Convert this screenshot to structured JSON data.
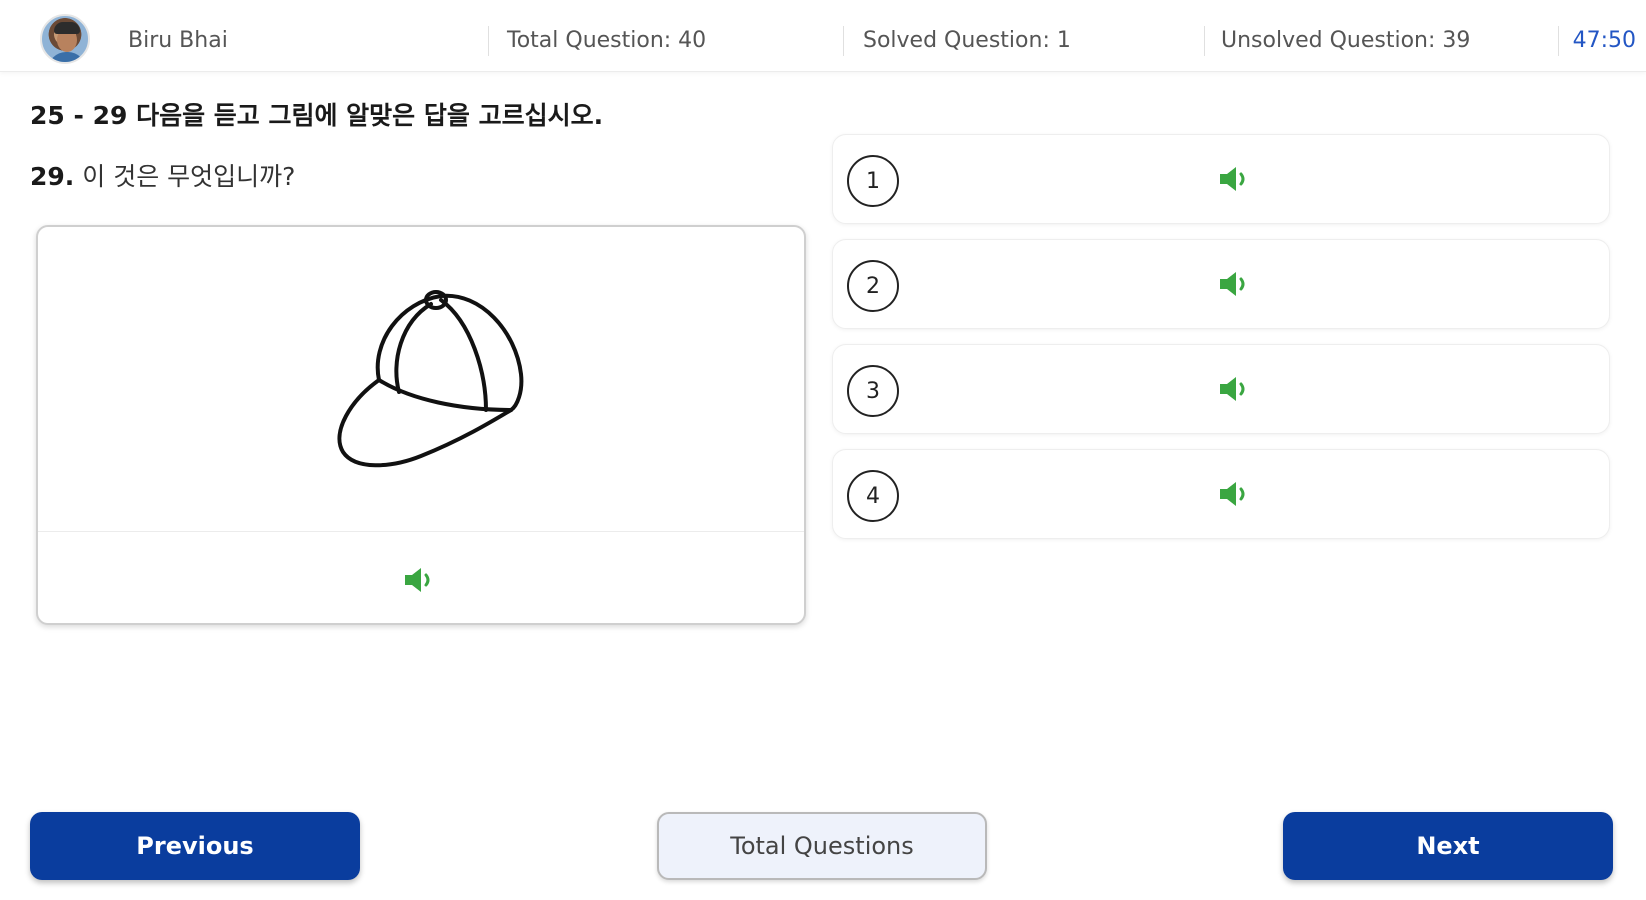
{
  "header": {
    "user_name": "Biru Bhai",
    "total_question": "Total Question: 40",
    "solved_question": "Solved Question: 1",
    "unsolved_question": "Unsolved Question: 39",
    "timer": "47:50"
  },
  "question": {
    "instruction": "25 - 29 다음을 듣고 그림에 알맞은 답을 고르십시오.",
    "number": "29.",
    "text": "이 것은 무엇입니까?"
  },
  "image_card": {
    "image_icon": "baseball-cap-drawing",
    "audio_icon": "speaker-icon"
  },
  "options": [
    {
      "label": "1"
    },
    {
      "label": "2"
    },
    {
      "label": "3"
    },
    {
      "label": "4"
    }
  ],
  "footer": {
    "previous_label": "Previous",
    "total_questions_label": "Total Questions",
    "next_label": "Next"
  },
  "colors": {
    "primary_button": "#0a3d9e",
    "audio_icon": "#3aa641",
    "timer": "#2356c4"
  }
}
